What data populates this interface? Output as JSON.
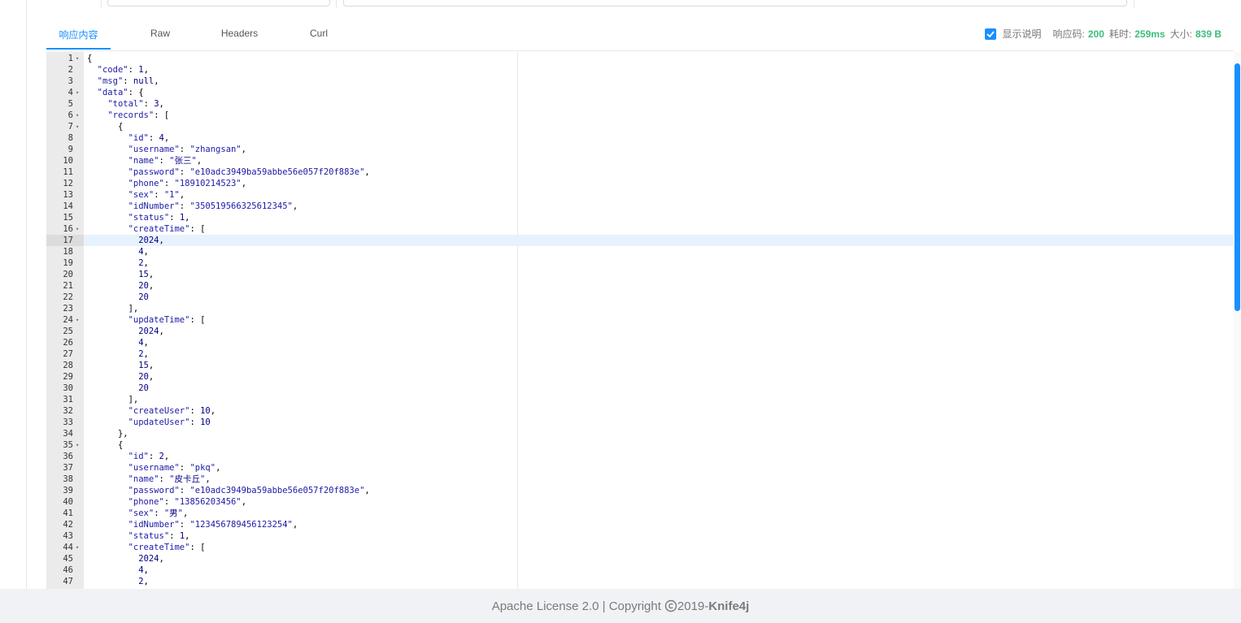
{
  "tabs": [
    {
      "label": "响应内容",
      "active": true
    },
    {
      "label": "Raw",
      "active": false
    },
    {
      "label": "Headers",
      "active": false
    },
    {
      "label": "Curl",
      "active": false
    }
  ],
  "meta": {
    "show_desc_label": "显示说明",
    "show_desc_checked": true,
    "status_label": "响应码:",
    "status_value": "200",
    "time_label": "耗时:",
    "time_value": "259ms",
    "size_label": "大小:",
    "size_value": "839 B",
    "value_color": "#3dbd7d"
  },
  "editor": {
    "active_line": 17,
    "lines": [
      {
        "n": "1",
        "fold": true,
        "html": "<span class='p'>{</span>"
      },
      {
        "n": "2",
        "fold": false,
        "html": "  <span class='k'>\"code\"</span><span class='p'>: </span><span class='n'>1</span><span class='p'>,</span>"
      },
      {
        "n": "3",
        "fold": false,
        "html": "  <span class='k'>\"msg\"</span><span class='p'>: </span><span class='nul'>null</span><span class='p'>,</span>"
      },
      {
        "n": "4",
        "fold": true,
        "html": "  <span class='k'>\"data\"</span><span class='p'>: {</span>"
      },
      {
        "n": "5",
        "fold": false,
        "html": "    <span class='k'>\"total\"</span><span class='p'>: </span><span class='n'>3</span><span class='p'>,</span>"
      },
      {
        "n": "6",
        "fold": true,
        "html": "    <span class='k'>\"records\"</span><span class='p'>: [</span>"
      },
      {
        "n": "7",
        "fold": true,
        "html": "      <span class='p'>{</span>"
      },
      {
        "n": "8",
        "fold": false,
        "html": "        <span class='k'>\"id\"</span><span class='p'>: </span><span class='n'>4</span><span class='p'>,</span>"
      },
      {
        "n": "9",
        "fold": false,
        "html": "        <span class='k'>\"username\"</span><span class='p'>: </span><span class='s'>\"zhangsan\"</span><span class='p'>,</span>"
      },
      {
        "n": "10",
        "fold": false,
        "html": "        <span class='k'>\"name\"</span><span class='p'>: </span><span class='s'>\"<span class='cjk'>张三</span>\"</span><span class='p'>,</span>"
      },
      {
        "n": "11",
        "fold": false,
        "html": "        <span class='k'>\"password\"</span><span class='p'>: </span><span class='s'>\"e10adc3949ba59abbe56e057f20f883e\"</span><span class='p'>,</span>"
      },
      {
        "n": "12",
        "fold": false,
        "html": "        <span class='k'>\"phone\"</span><span class='p'>: </span><span class='s'>\"18910214523\"</span><span class='p'>,</span>"
      },
      {
        "n": "13",
        "fold": false,
        "html": "        <span class='k'>\"sex\"</span><span class='p'>: </span><span class='s'>\"1\"</span><span class='p'>,</span>"
      },
      {
        "n": "14",
        "fold": false,
        "html": "        <span class='k'>\"idNumber\"</span><span class='p'>: </span><span class='s'>\"350519566325612345\"</span><span class='p'>,</span>"
      },
      {
        "n": "15",
        "fold": false,
        "html": "        <span class='k'>\"status\"</span><span class='p'>: </span><span class='n'>1</span><span class='p'>,</span>"
      },
      {
        "n": "16",
        "fold": true,
        "html": "        <span class='k'>\"createTime\"</span><span class='p'>: [</span>"
      },
      {
        "n": "17",
        "fold": false,
        "html": "          <span class='n'>2024</span><span class='p'>,</span>"
      },
      {
        "n": "18",
        "fold": false,
        "html": "          <span class='n'>4</span><span class='p'>,</span>"
      },
      {
        "n": "19",
        "fold": false,
        "html": "          <span class='n'>2</span><span class='p'>,</span>"
      },
      {
        "n": "20",
        "fold": false,
        "html": "          <span class='n'>15</span><span class='p'>,</span>"
      },
      {
        "n": "21",
        "fold": false,
        "html": "          <span class='n'>20</span><span class='p'>,</span>"
      },
      {
        "n": "22",
        "fold": false,
        "html": "          <span class='n'>20</span>"
      },
      {
        "n": "23",
        "fold": false,
        "html": "        <span class='p'>],</span>"
      },
      {
        "n": "24",
        "fold": true,
        "html": "        <span class='k'>\"updateTime\"</span><span class='p'>: [</span>"
      },
      {
        "n": "25",
        "fold": false,
        "html": "          <span class='n'>2024</span><span class='p'>,</span>"
      },
      {
        "n": "26",
        "fold": false,
        "html": "          <span class='n'>4</span><span class='p'>,</span>"
      },
      {
        "n": "27",
        "fold": false,
        "html": "          <span class='n'>2</span><span class='p'>,</span>"
      },
      {
        "n": "28",
        "fold": false,
        "html": "          <span class='n'>15</span><span class='p'>,</span>"
      },
      {
        "n": "29",
        "fold": false,
        "html": "          <span class='n'>20</span><span class='p'>,</span>"
      },
      {
        "n": "30",
        "fold": false,
        "html": "          <span class='n'>20</span>"
      },
      {
        "n": "31",
        "fold": false,
        "html": "        <span class='p'>],</span>"
      },
      {
        "n": "32",
        "fold": false,
        "html": "        <span class='k'>\"createUser\"</span><span class='p'>: </span><span class='n'>10</span><span class='p'>,</span>"
      },
      {
        "n": "33",
        "fold": false,
        "html": "        <span class='k'>\"updateUser\"</span><span class='p'>: </span><span class='n'>10</span>"
      },
      {
        "n": "34",
        "fold": false,
        "html": "      <span class='p'>},</span>"
      },
      {
        "n": "35",
        "fold": true,
        "html": "      <span class='p'>{</span>"
      },
      {
        "n": "36",
        "fold": false,
        "html": "        <span class='k'>\"id\"</span><span class='p'>: </span><span class='n'>2</span><span class='p'>,</span>"
      },
      {
        "n": "37",
        "fold": false,
        "html": "        <span class='k'>\"username\"</span><span class='p'>: </span><span class='s'>\"pkq\"</span><span class='p'>,</span>"
      },
      {
        "n": "38",
        "fold": false,
        "html": "        <span class='k'>\"name\"</span><span class='p'>: </span><span class='s'>\"<span class='cjk'>皮卡丘</span>\"</span><span class='p'>,</span>"
      },
      {
        "n": "39",
        "fold": false,
        "html": "        <span class='k'>\"password\"</span><span class='p'>: </span><span class='s'>\"e10adc3949ba59abbe56e057f20f883e\"</span><span class='p'>,</span>"
      },
      {
        "n": "40",
        "fold": false,
        "html": "        <span class='k'>\"phone\"</span><span class='p'>: </span><span class='s'>\"13856203456\"</span><span class='p'>,</span>"
      },
      {
        "n": "41",
        "fold": false,
        "html": "        <span class='k'>\"sex\"</span><span class='p'>: </span><span class='s'>\"<span class='cjk'>男</span>\"</span><span class='p'>,</span>"
      },
      {
        "n": "42",
        "fold": false,
        "html": "        <span class='k'>\"idNumber\"</span><span class='p'>: </span><span class='s'>\"123456789456123254\"</span><span class='p'>,</span>"
      },
      {
        "n": "43",
        "fold": false,
        "html": "        <span class='k'>\"status\"</span><span class='p'>: </span><span class='n'>1</span><span class='p'>,</span>"
      },
      {
        "n": "44",
        "fold": true,
        "html": "        <span class='k'>\"createTime\"</span><span class='p'>: [</span>"
      },
      {
        "n": "45",
        "fold": false,
        "html": "          <span class='n'>2024</span><span class='p'>,</span>"
      },
      {
        "n": "46",
        "fold": false,
        "html": "          <span class='n'>4</span><span class='p'>,</span>"
      },
      {
        "n": "47",
        "fold": false,
        "html": "          <span class='n'>2</span><span class='p'>,</span>"
      }
    ]
  },
  "footer": {
    "license": "Apache License 2.0 | Copyright",
    "copyright_icon": "copyright-icon",
    "year": " 2019-",
    "brand": "Knife4j"
  }
}
